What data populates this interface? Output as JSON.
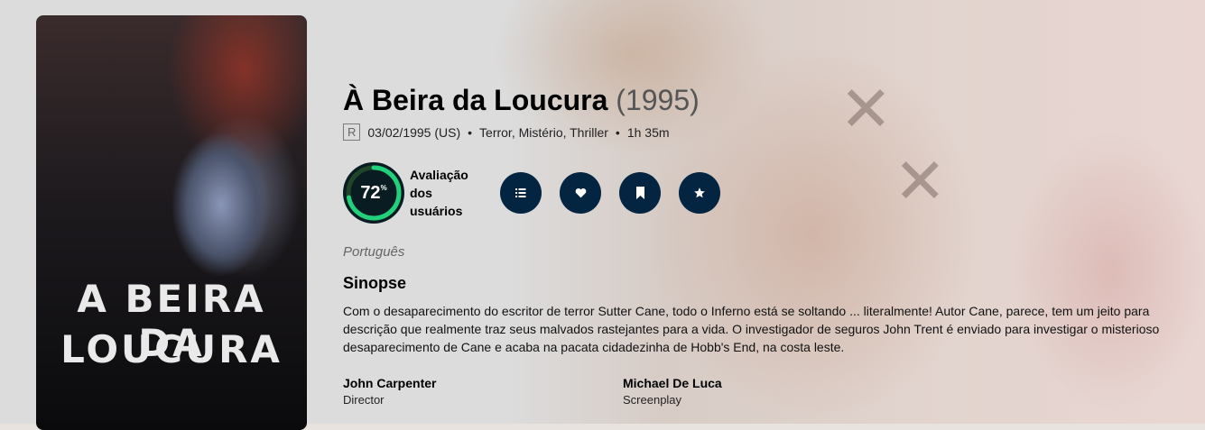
{
  "movie": {
    "title": "À Beira da Loucura",
    "year": "(1995)",
    "certification": "R",
    "release": "03/02/1995 (US)",
    "genres": "Terror, Mistério, Thriller",
    "runtime": "1h 35m"
  },
  "poster": {
    "line1": "A BEIRA DA",
    "line2": "LOUCURA"
  },
  "score": {
    "value": "72",
    "unit": "%",
    "fraction": 0.72,
    "label_line1": "Avaliação",
    "label_line2": "dos",
    "label_line3": "usuários",
    "ring_color": "#21d07a",
    "track_color": "#204529"
  },
  "actions": [
    {
      "icon": "list-icon"
    },
    {
      "icon": "heart-icon"
    },
    {
      "icon": "bookmark-icon"
    },
    {
      "icon": "star-icon"
    }
  ],
  "language": "Português",
  "overview_heading": "Sinopse",
  "overview": "Com o desaparecimento do escritor de terror Sutter Cane, todo o Inferno está se soltando ... literalmente! Autor Cane, parece, tem um jeito para descrição que realmente traz seus malvados rastejantes para a vida. O investigador de seguros John Trent é enviado para investigar o misterioso desaparecimento de Cane e acaba na pacata cidadezinha de Hobb's End, na costa leste.",
  "crew": [
    {
      "name": "John Carpenter",
      "role": "Director"
    },
    {
      "name": "Michael De Luca",
      "role": "Screenplay"
    }
  ],
  "colors": {
    "accent_dark": "#032541",
    "score_bg": "#081c22"
  }
}
